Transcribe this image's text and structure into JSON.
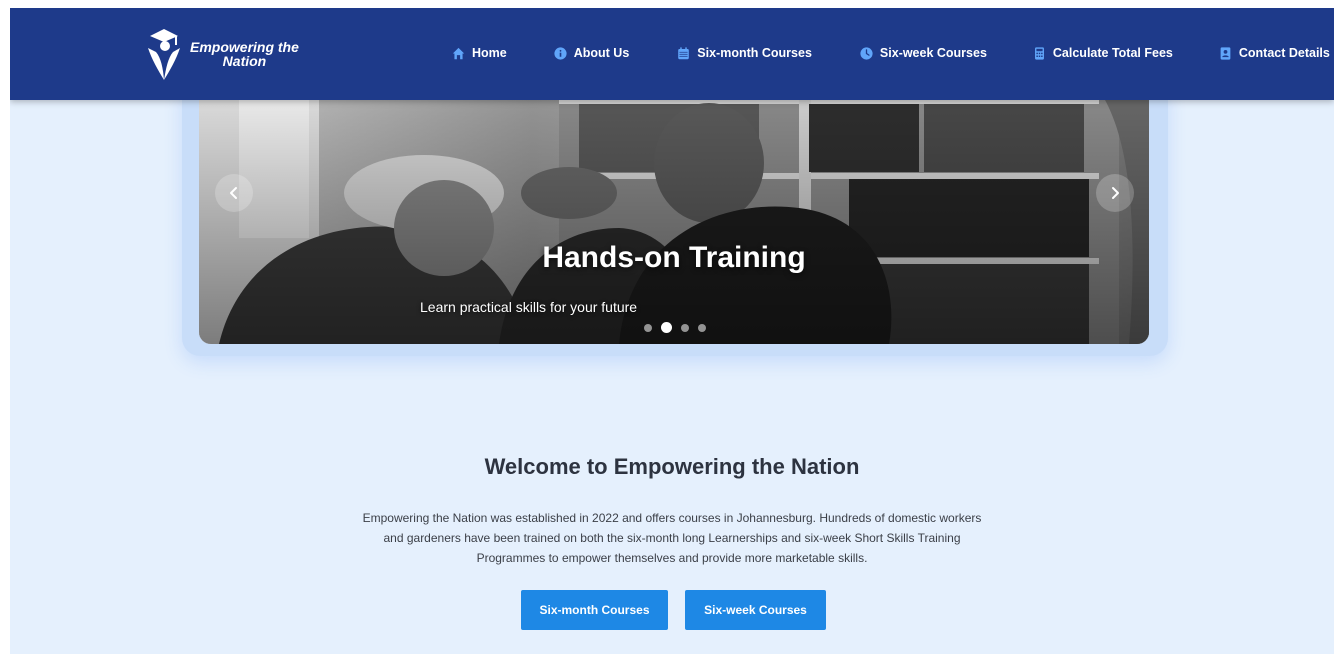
{
  "brand": {
    "line1": "Empowering the",
    "line2": "Nation",
    "logo_icon": "graduate-icon"
  },
  "nav": [
    {
      "label": "Home",
      "icon": "home-icon"
    },
    {
      "label": "About Us",
      "icon": "info-icon"
    },
    {
      "label": "Six-month Courses",
      "icon": "calendar-icon"
    },
    {
      "label": "Six-week Courses",
      "icon": "clock-icon"
    },
    {
      "label": "Calculate Total Fees",
      "icon": "calculator-icon"
    },
    {
      "label": "Contact Details",
      "icon": "contact-icon"
    }
  ],
  "carousel": {
    "title": "Hands-on Training",
    "subtitle": "Learn practical skills for your future",
    "slide_count": 4,
    "active_slide": 2
  },
  "welcome": {
    "title": "Welcome to Empowering the Nation",
    "body": "Empowering the Nation was established in 2022 and offers courses in Johannesburg. Hundreds of domestic workers and gardeners have been trained on both the six-month long Learnerships and six-week Short Skills Training Programmes to empower themselves and provide more marketable skills.",
    "button_six_month": "Six-month Courses",
    "button_six_week": "Six-week Courses"
  },
  "colors": {
    "nav_bg": "#1e3a8a",
    "page_bg": "#e5f0fd",
    "button_bg": "#1e88e5",
    "accent_icon": "#60a5fa"
  }
}
